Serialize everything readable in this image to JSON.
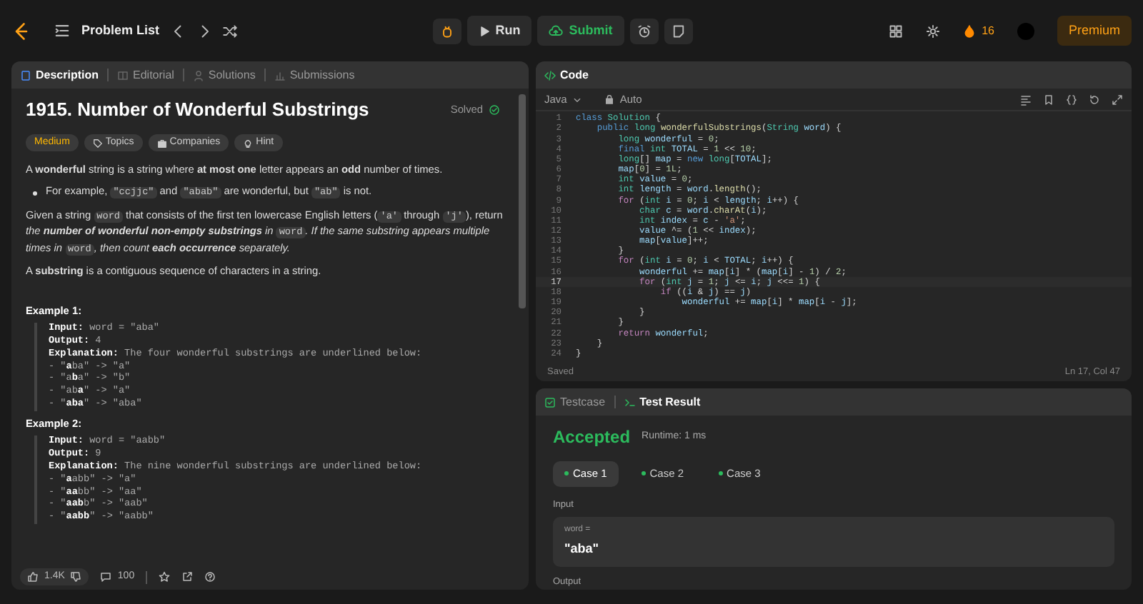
{
  "topbar": {
    "problem_list": "Problem List",
    "run": "Run",
    "submit": "Submit",
    "streak": "16",
    "premium": "Premium"
  },
  "description": {
    "tabs": [
      {
        "label": "Description",
        "selected": true
      },
      {
        "label": "Editorial",
        "selected": false
      },
      {
        "label": "Solutions",
        "selected": false
      },
      {
        "label": "Submissions",
        "selected": false
      }
    ],
    "title": "1915. Number of Wonderful Substrings",
    "solved": "Solved",
    "tags": [
      {
        "kind": "difficulty",
        "label": "Medium"
      },
      {
        "kind": "topics",
        "label": "Topics"
      },
      {
        "kind": "companies",
        "label": "Companies"
      },
      {
        "kind": "hint",
        "label": "Hint"
      }
    ],
    "blocks": [
      {
        "kind": "para",
        "segments": [
          {
            "kind": "text",
            "text": "A **wonderful** string is a string where **at most one** letter appears an **odd** number of times."
          }
        ]
      },
      {
        "kind": "bullet",
        "segments": [
          {
            "kind": "text",
            "text": "For example, "
          },
          {
            "kind": "code",
            "text": "\"ccjjc\""
          },
          {
            "kind": "text",
            "text": " and "
          },
          {
            "kind": "code",
            "text": "\"abab\""
          },
          {
            "kind": "text",
            "text": " are wonderful, but "
          },
          {
            "kind": "code",
            "text": "\"ab\""
          },
          {
            "kind": "text",
            "text": " is not."
          }
        ]
      },
      {
        "kind": "para",
        "segments": [
          {
            "kind": "text",
            "text": "Given a string "
          },
          {
            "kind": "code",
            "text": "word"
          },
          {
            "kind": "text",
            "text": " that consists of the first ten lowercase English letters ("
          },
          {
            "kind": "code",
            "text": "'a'"
          },
          {
            "kind": "text",
            "text": " through "
          },
          {
            "kind": "code",
            "text": "'j'"
          },
          {
            "kind": "text",
            "text": "), return "
          },
          {
            "kind": "italic",
            "text": "the **number of wonderful non-empty substrings** in "
          },
          {
            "kind": "code",
            "text": "word"
          },
          {
            "kind": "italic",
            "text": ". If the same substring appears multiple times in "
          },
          {
            "kind": "code",
            "text": "word"
          },
          {
            "kind": "italic",
            "text": ", then count **each occurrence** separately."
          }
        ]
      },
      {
        "kind": "para",
        "segments": [
          {
            "kind": "text",
            "text": "A **substring** is a contiguous sequence of characters in a string."
          }
        ]
      }
    ],
    "examples": [
      {
        "title": "Example 1:",
        "lines": [
          "**Input:** word = \"aba\"",
          "**Output:** 4",
          "**Explanation:** The four wonderful substrings are underlined below:",
          "- \"**a**ba\" -> \"a\"",
          "- \"a**b**a\" -> \"b\"",
          "- \"ab**a**\" -> \"a\"",
          "- \"**aba**\" -> \"aba\""
        ]
      },
      {
        "title": "Example 2:",
        "lines": [
          "**Input:** word = \"aabb\"",
          "**Output:** 9",
          "**Explanation:** The nine wonderful substrings are underlined below:",
          "- \"**a**abb\" -> \"a\"",
          "- \"**aa**bb\" -> \"aa\"",
          "- \"**aab**b\" -> \"aab\"",
          "- \"**aabb**\" -> \"aabb\""
        ]
      }
    ],
    "likes": "1.4K",
    "comments": "100"
  },
  "code": {
    "title": "Code",
    "language": "Java",
    "mode": "Auto",
    "status": "Saved",
    "cursor": "Ln 17, Col 47",
    "lines": [
      {
        "n": "1",
        "current": false,
        "tokens": [
          {
            "kind": "keyword",
            "text": "class "
          },
          {
            "kind": "type",
            "text": "Solution"
          },
          {
            "kind": "punct",
            "text": " {"
          }
        ]
      },
      {
        "n": "2",
        "current": false,
        "tokens": [
          {
            "kind": "keyword",
            "text": "    public "
          },
          {
            "kind": "type",
            "text": "long "
          },
          {
            "kind": "func",
            "text": "wonderfulSubstrings"
          },
          {
            "kind": "punct",
            "text": "("
          },
          {
            "kind": "type",
            "text": "String "
          },
          {
            "kind": "var",
            "text": "word"
          },
          {
            "kind": "punct",
            "text": ") {"
          }
        ]
      },
      {
        "n": "3",
        "current": false,
        "tokens": [
          {
            "kind": "type",
            "text": "        long "
          },
          {
            "kind": "var",
            "text": "wonderful"
          },
          {
            "kind": "punct",
            "text": " = "
          },
          {
            "kind": "num",
            "text": "0"
          },
          {
            "kind": "punct",
            "text": ";"
          }
        ]
      },
      {
        "n": "4",
        "current": false,
        "tokens": [
          {
            "kind": "keyword",
            "text": "        final "
          },
          {
            "kind": "type",
            "text": "int "
          },
          {
            "kind": "var",
            "text": "TOTAL"
          },
          {
            "kind": "punct",
            "text": " = "
          },
          {
            "kind": "num",
            "text": "1"
          },
          {
            "kind": "punct",
            "text": " << "
          },
          {
            "kind": "num",
            "text": "10"
          },
          {
            "kind": "punct",
            "text": ";"
          }
        ]
      },
      {
        "n": "5",
        "current": false,
        "tokens": [
          {
            "kind": "type",
            "text": "        long"
          },
          {
            "kind": "punct",
            "text": "[] "
          },
          {
            "kind": "var",
            "text": "map"
          },
          {
            "kind": "punct",
            "text": " = "
          },
          {
            "kind": "keyword",
            "text": "new "
          },
          {
            "kind": "type",
            "text": "long"
          },
          {
            "kind": "punct",
            "text": "["
          },
          {
            "kind": "var",
            "text": "TOTAL"
          },
          {
            "kind": "punct",
            "text": "];"
          }
        ]
      },
      {
        "n": "6",
        "current": false,
        "tokens": [
          {
            "kind": "var",
            "text": "        map"
          },
          {
            "kind": "punct",
            "text": "["
          },
          {
            "kind": "num",
            "text": "0"
          },
          {
            "kind": "punct",
            "text": "] = "
          },
          {
            "kind": "num",
            "text": "1L"
          },
          {
            "kind": "punct",
            "text": ";"
          }
        ]
      },
      {
        "n": "7",
        "current": false,
        "tokens": [
          {
            "kind": "type",
            "text": "        int "
          },
          {
            "kind": "var",
            "text": "value"
          },
          {
            "kind": "punct",
            "text": " = "
          },
          {
            "kind": "num",
            "text": "0"
          },
          {
            "kind": "punct",
            "text": ";"
          }
        ]
      },
      {
        "n": "8",
        "current": false,
        "tokens": [
          {
            "kind": "type",
            "text": "        int "
          },
          {
            "kind": "var",
            "text": "length"
          },
          {
            "kind": "punct",
            "text": " = "
          },
          {
            "kind": "var",
            "text": "word"
          },
          {
            "kind": "punct",
            "text": "."
          },
          {
            "kind": "func",
            "text": "length"
          },
          {
            "kind": "punct",
            "text": "();"
          }
        ]
      },
      {
        "n": "9",
        "current": false,
        "tokens": [
          {
            "kind": "control",
            "text": "        for "
          },
          {
            "kind": "punct",
            "text": "("
          },
          {
            "kind": "type",
            "text": "int "
          },
          {
            "kind": "var",
            "text": "i"
          },
          {
            "kind": "punct",
            "text": " = "
          },
          {
            "kind": "num",
            "text": "0"
          },
          {
            "kind": "punct",
            "text": "; "
          },
          {
            "kind": "var",
            "text": "i"
          },
          {
            "kind": "punct",
            "text": " < "
          },
          {
            "kind": "var",
            "text": "length"
          },
          {
            "kind": "punct",
            "text": "; "
          },
          {
            "kind": "var",
            "text": "i"
          },
          {
            "kind": "punct",
            "text": "++) {"
          }
        ]
      },
      {
        "n": "10",
        "current": false,
        "tokens": [
          {
            "kind": "type",
            "text": "            char "
          },
          {
            "kind": "var",
            "text": "c"
          },
          {
            "kind": "punct",
            "text": " = "
          },
          {
            "kind": "var",
            "text": "word"
          },
          {
            "kind": "punct",
            "text": "."
          },
          {
            "kind": "func",
            "text": "charAt"
          },
          {
            "kind": "punct",
            "text": "("
          },
          {
            "kind": "var",
            "text": "i"
          },
          {
            "kind": "punct",
            "text": ");"
          }
        ]
      },
      {
        "n": "11",
        "current": false,
        "tokens": [
          {
            "kind": "type",
            "text": "            int "
          },
          {
            "kind": "var",
            "text": "index"
          },
          {
            "kind": "punct",
            "text": " = "
          },
          {
            "kind": "var",
            "text": "c"
          },
          {
            "kind": "punct",
            "text": " - "
          },
          {
            "kind": "string",
            "text": "'a'"
          },
          {
            "kind": "punct",
            "text": ";"
          }
        ]
      },
      {
        "n": "12",
        "current": false,
        "tokens": [
          {
            "kind": "var",
            "text": "            value"
          },
          {
            "kind": "punct",
            "text": " ^= ("
          },
          {
            "kind": "num",
            "text": "1"
          },
          {
            "kind": "punct",
            "text": " << "
          },
          {
            "kind": "var",
            "text": "index"
          },
          {
            "kind": "punct",
            "text": ");"
          }
        ]
      },
      {
        "n": "13",
        "current": false,
        "tokens": [
          {
            "kind": "var",
            "text": "            map"
          },
          {
            "kind": "punct",
            "text": "["
          },
          {
            "kind": "var",
            "text": "value"
          },
          {
            "kind": "punct",
            "text": "]++;"
          }
        ]
      },
      {
        "n": "14",
        "current": false,
        "tokens": [
          {
            "kind": "punct",
            "text": "        }"
          }
        ]
      },
      {
        "n": "15",
        "current": false,
        "tokens": [
          {
            "kind": "control",
            "text": "        for "
          },
          {
            "kind": "punct",
            "text": "("
          },
          {
            "kind": "type",
            "text": "int "
          },
          {
            "kind": "var",
            "text": "i"
          },
          {
            "kind": "punct",
            "text": " = "
          },
          {
            "kind": "num",
            "text": "0"
          },
          {
            "kind": "punct",
            "text": "; "
          },
          {
            "kind": "var",
            "text": "i"
          },
          {
            "kind": "punct",
            "text": " < "
          },
          {
            "kind": "var",
            "text": "TOTAL"
          },
          {
            "kind": "punct",
            "text": "; "
          },
          {
            "kind": "var",
            "text": "i"
          },
          {
            "kind": "punct",
            "text": "++) {"
          }
        ]
      },
      {
        "n": "16",
        "current": false,
        "tokens": [
          {
            "kind": "var",
            "text": "            wonderful"
          },
          {
            "kind": "punct",
            "text": " += "
          },
          {
            "kind": "var",
            "text": "map"
          },
          {
            "kind": "punct",
            "text": "["
          },
          {
            "kind": "var",
            "text": "i"
          },
          {
            "kind": "punct",
            "text": "] * ("
          },
          {
            "kind": "var",
            "text": "map"
          },
          {
            "kind": "punct",
            "text": "["
          },
          {
            "kind": "var",
            "text": "i"
          },
          {
            "kind": "punct",
            "text": "] - "
          },
          {
            "kind": "num",
            "text": "1"
          },
          {
            "kind": "punct",
            "text": ") / "
          },
          {
            "kind": "num",
            "text": "2"
          },
          {
            "kind": "punct",
            "text": ";"
          }
        ]
      },
      {
        "n": "17",
        "current": true,
        "tokens": [
          {
            "kind": "control",
            "text": "            for "
          },
          {
            "kind": "punct",
            "text": "("
          },
          {
            "kind": "type",
            "text": "int "
          },
          {
            "kind": "var",
            "text": "j"
          },
          {
            "kind": "punct",
            "text": " = "
          },
          {
            "kind": "num",
            "text": "1"
          },
          {
            "kind": "punct",
            "text": "; "
          },
          {
            "kind": "var",
            "text": "j"
          },
          {
            "kind": "punct",
            "text": " <= "
          },
          {
            "kind": "var",
            "text": "i"
          },
          {
            "kind": "punct",
            "text": "; "
          },
          {
            "kind": "var",
            "text": "j"
          },
          {
            "kind": "punct",
            "text": " <<= "
          },
          {
            "kind": "num",
            "text": "1"
          },
          {
            "kind": "punct",
            "text": ") {"
          }
        ]
      },
      {
        "n": "18",
        "current": false,
        "tokens": [
          {
            "kind": "control",
            "text": "                if "
          },
          {
            "kind": "punct",
            "text": "(("
          },
          {
            "kind": "var",
            "text": "i"
          },
          {
            "kind": "punct",
            "text": " & "
          },
          {
            "kind": "var",
            "text": "j"
          },
          {
            "kind": "punct",
            "text": ") == "
          },
          {
            "kind": "var",
            "text": "j"
          },
          {
            "kind": "punct",
            "text": ")"
          }
        ]
      },
      {
        "n": "19",
        "current": false,
        "tokens": [
          {
            "kind": "var",
            "text": "                    wonderful"
          },
          {
            "kind": "punct",
            "text": " += "
          },
          {
            "kind": "var",
            "text": "map"
          },
          {
            "kind": "punct",
            "text": "["
          },
          {
            "kind": "var",
            "text": "i"
          },
          {
            "kind": "punct",
            "text": "] * "
          },
          {
            "kind": "var",
            "text": "map"
          },
          {
            "kind": "punct",
            "text": "["
          },
          {
            "kind": "var",
            "text": "i"
          },
          {
            "kind": "punct",
            "text": " - "
          },
          {
            "kind": "var",
            "text": "j"
          },
          {
            "kind": "punct",
            "text": "];"
          }
        ]
      },
      {
        "n": "20",
        "current": false,
        "tokens": [
          {
            "kind": "punct",
            "text": "            }"
          }
        ]
      },
      {
        "n": "21",
        "current": false,
        "tokens": [
          {
            "kind": "punct",
            "text": "        }"
          }
        ]
      },
      {
        "n": "22",
        "current": false,
        "tokens": [
          {
            "kind": "control",
            "text": "        return "
          },
          {
            "kind": "var",
            "text": "wonderful"
          },
          {
            "kind": "punct",
            "text": ";"
          }
        ]
      },
      {
        "n": "23",
        "current": false,
        "tokens": [
          {
            "kind": "punct",
            "text": "    }"
          }
        ]
      },
      {
        "n": "24",
        "current": false,
        "tokens": [
          {
            "kind": "punct",
            "text": "}"
          }
        ]
      }
    ]
  },
  "tests": {
    "tabs": [
      {
        "label": "Testcase",
        "selected": false
      },
      {
        "label": "Test Result",
        "selected": true
      }
    ],
    "verdict": "Accepted",
    "runtime": "Runtime: 1 ms",
    "cases": [
      {
        "label": "Case 1",
        "selected": true,
        "passed": true
      },
      {
        "label": "Case 2",
        "selected": false,
        "passed": true
      },
      {
        "label": "Case 3",
        "selected": false,
        "passed": true
      }
    ],
    "input_label": "Input",
    "param_name": "word =",
    "param_value": "\"aba\"",
    "output_label": "Output"
  }
}
